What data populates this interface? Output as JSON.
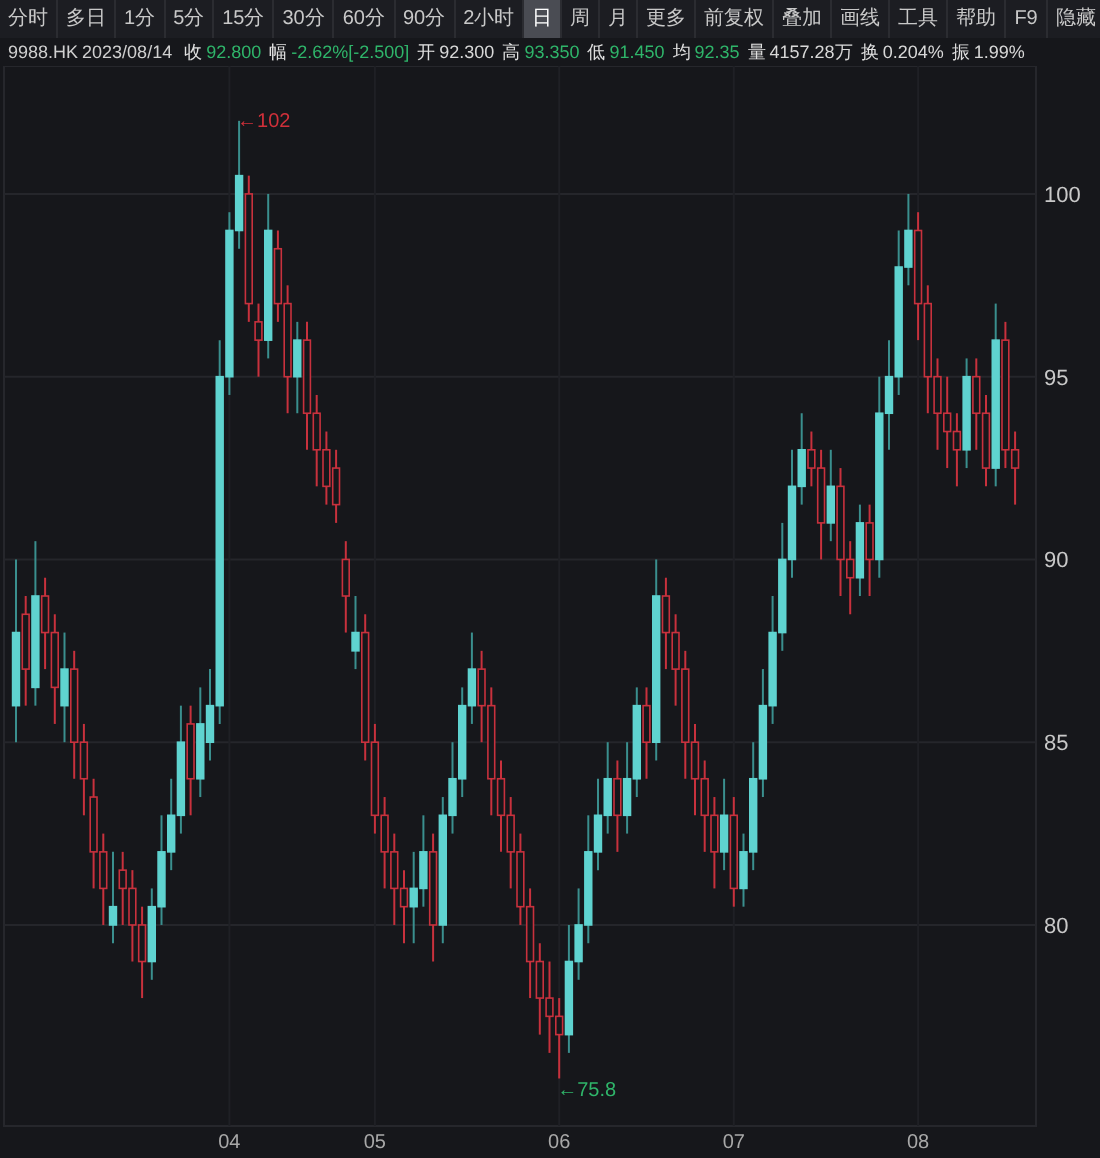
{
  "toolbar": [
    {
      "label": "分时",
      "selected": false
    },
    {
      "label": "多日",
      "selected": false
    },
    {
      "label": "1分",
      "selected": false
    },
    {
      "label": "5分",
      "selected": false
    },
    {
      "label": "15分",
      "selected": false
    },
    {
      "label": "30分",
      "selected": false
    },
    {
      "label": "60分",
      "selected": false
    },
    {
      "label": "90分",
      "selected": false
    },
    {
      "label": "2小时",
      "selected": false
    },
    {
      "label": "日",
      "selected": true
    },
    {
      "label": "周",
      "selected": false
    },
    {
      "label": "月",
      "selected": false
    },
    {
      "label": "更多",
      "selected": false
    }
  ],
  "tools": [
    "前复权",
    "叠加",
    "画线",
    "工具",
    "帮助",
    "F9",
    "隐藏"
  ],
  "quote": {
    "symbol": "9988.HK",
    "date": "2023/08/14",
    "fields": [
      {
        "label": "收",
        "value": "92.800",
        "color": "#2fb56a"
      },
      {
        "label": "幅",
        "value": "-2.62%[-2.500]",
        "color": "#2fb56a"
      },
      {
        "label": "开",
        "value": "92.300",
        "color": "#d8d8d8"
      },
      {
        "label": "高",
        "value": "93.350",
        "color": "#2fb56a"
      },
      {
        "label": "低",
        "value": "91.450",
        "color": "#2fb56a"
      },
      {
        "label": "均",
        "value": "92.35",
        "color": "#2fb56a"
      },
      {
        "label": "量",
        "value": "4157.28万",
        "color": "#d8d8d8"
      },
      {
        "label": "换",
        "value": "0.204%",
        "color": "#d8d8d8"
      },
      {
        "label": "振",
        "value": "1.99%",
        "color": "#d8d8d8"
      }
    ]
  },
  "chart": {
    "chart_data": {
      "type": "candlestick",
      "grid": true,
      "ylim": [
        74.5,
        103.5
      ],
      "yticks": [
        80,
        85,
        90,
        95,
        100
      ],
      "categories": [
        null,
        null,
        null,
        null,
        null,
        null,
        null,
        null,
        null,
        null,
        null,
        null,
        null,
        null,
        null,
        null,
        null,
        null,
        null,
        null,
        null,
        null,
        "04",
        null,
        null,
        null,
        null,
        null,
        null,
        null,
        null,
        null,
        null,
        null,
        null,
        null,
        null,
        "05",
        null,
        null,
        null,
        null,
        null,
        null,
        null,
        null,
        null,
        null,
        null,
        null,
        null,
        null,
        null,
        null,
        null,
        null,
        "06",
        null,
        null,
        null,
        null,
        null,
        null,
        null,
        null,
        null,
        null,
        null,
        null,
        null,
        null,
        null,
        null,
        null,
        "07",
        null,
        null,
        null,
        null,
        null,
        null,
        null,
        null,
        null,
        null,
        null,
        null,
        null,
        null,
        null,
        null,
        null,
        null,
        "08",
        null,
        null,
        null,
        null,
        null,
        null,
        null,
        null,
        null,
        null
      ],
      "ohlc": [
        [
          86,
          90,
          85,
          88
        ],
        [
          88.5,
          89,
          86,
          87
        ],
        [
          86.5,
          90.5,
          86,
          89
        ],
        [
          89,
          89.5,
          87,
          88
        ],
        [
          88,
          88.5,
          85.5,
          86.5
        ],
        [
          86,
          88,
          85,
          87
        ],
        [
          87,
          87.5,
          84,
          85
        ],
        [
          85,
          85.5,
          83,
          84
        ],
        [
          83.5,
          84,
          81,
          82
        ],
        [
          82,
          82.5,
          80,
          81
        ],
        [
          80,
          82,
          79.5,
          80.5
        ],
        [
          81.5,
          82,
          80,
          81
        ],
        [
          81,
          81.5,
          79,
          80
        ],
        [
          80,
          80.5,
          78,
          79
        ],
        [
          79,
          81,
          78.5,
          80.5
        ],
        [
          80.5,
          83,
          80,
          82
        ],
        [
          82,
          84,
          81.5,
          83
        ],
        [
          83,
          86,
          82.5,
          85
        ],
        [
          85.5,
          86,
          83,
          84
        ],
        [
          84,
          86.5,
          83.5,
          85.5
        ],
        [
          85,
          87,
          84.5,
          86
        ],
        [
          86,
          96,
          85.5,
          95
        ],
        [
          95,
          99.5,
          94.5,
          99
        ],
        [
          99,
          102,
          98.5,
          100.5
        ],
        [
          100,
          100.5,
          96.5,
          97
        ],
        [
          96.5,
          97,
          95,
          96
        ],
        [
          96,
          100,
          95.5,
          99
        ],
        [
          98.5,
          99,
          96.5,
          97
        ],
        [
          97,
          97.5,
          94,
          95
        ],
        [
          95,
          96.5,
          94,
          96
        ],
        [
          96,
          96.5,
          93,
          94
        ],
        [
          94,
          94.5,
          92,
          93
        ],
        [
          93,
          93.5,
          91.5,
          92
        ],
        [
          92.5,
          93,
          91,
          91.5
        ],
        [
          90,
          90.5,
          88,
          89
        ],
        [
          87.5,
          89,
          87,
          88
        ],
        [
          88,
          88.5,
          84.5,
          85
        ],
        [
          85,
          85.5,
          82.5,
          83
        ],
        [
          83,
          83.5,
          81,
          82
        ],
        [
          82,
          82.5,
          80,
          81
        ],
        [
          81,
          81.5,
          79.5,
          80.5
        ],
        [
          80.5,
          82,
          79.5,
          81
        ],
        [
          81,
          83,
          80.5,
          82
        ],
        [
          82,
          82.5,
          79,
          80
        ],
        [
          80,
          83.5,
          79.5,
          83
        ],
        [
          83,
          85,
          82.5,
          84
        ],
        [
          84,
          86.5,
          83.5,
          86
        ],
        [
          86,
          88,
          85.5,
          87
        ],
        [
          87,
          87.5,
          85,
          86
        ],
        [
          86,
          86.5,
          83,
          84
        ],
        [
          84,
          84.5,
          82,
          83
        ],
        [
          83,
          83.5,
          81,
          82
        ],
        [
          82,
          82.5,
          80,
          80.5
        ],
        [
          80.5,
          81,
          78,
          79
        ],
        [
          79,
          79.5,
          77,
          78
        ],
        [
          78,
          79,
          76.5,
          77.5
        ],
        [
          77.5,
          78,
          75.8,
          77
        ],
        [
          77,
          80,
          76.5,
          79
        ],
        [
          79,
          81,
          78.5,
          80
        ],
        [
          80,
          83,
          79.5,
          82
        ],
        [
          82,
          84,
          81.5,
          83
        ],
        [
          83,
          85,
          82.5,
          84
        ],
        [
          84,
          84.5,
          82,
          83
        ],
        [
          83,
          85,
          82.5,
          84
        ],
        [
          84,
          86.5,
          83.5,
          86
        ],
        [
          86,
          86.5,
          84,
          85
        ],
        [
          85,
          90,
          84.5,
          89
        ],
        [
          89,
          89.5,
          87,
          88
        ],
        [
          88,
          88.5,
          86,
          87
        ],
        [
          87,
          87.5,
          84,
          85
        ],
        [
          85,
          85.5,
          83,
          84
        ],
        [
          84,
          84.5,
          82,
          83
        ],
        [
          83,
          83.5,
          81,
          82
        ],
        [
          82,
          84,
          81.5,
          83
        ],
        [
          83,
          83.5,
          80.5,
          81
        ],
        [
          81,
          82.5,
          80.5,
          82
        ],
        [
          82,
          85,
          81.5,
          84
        ],
        [
          84,
          87,
          83.5,
          86
        ],
        [
          86,
          89,
          85.5,
          88
        ],
        [
          88,
          91,
          87.5,
          90
        ],
        [
          90,
          93,
          89.5,
          92
        ],
        [
          92,
          94,
          91.5,
          93
        ],
        [
          93,
          93.5,
          92,
          92.5
        ],
        [
          92.5,
          93,
          90,
          91
        ],
        [
          91,
          93,
          90.5,
          92
        ],
        [
          92,
          92.5,
          89,
          90
        ],
        [
          90,
          90.5,
          88.5,
          89.5
        ],
        [
          89.5,
          91.5,
          89,
          91
        ],
        [
          91,
          91.5,
          89,
          90
        ],
        [
          90,
          95,
          89.5,
          94
        ],
        [
          94,
          96,
          93,
          95
        ],
        [
          95,
          99,
          94.5,
          98
        ],
        [
          98,
          100,
          97.5,
          99
        ],
        [
          99,
          99.5,
          96,
          97
        ],
        [
          97,
          97.5,
          94,
          95
        ],
        [
          95,
          95.5,
          93,
          94
        ],
        [
          94,
          95,
          92.5,
          93.5
        ],
        [
          93.5,
          94,
          92,
          93
        ],
        [
          93,
          95.5,
          92.5,
          95
        ],
        [
          95,
          95.5,
          93,
          94
        ],
        [
          94,
          94.5,
          92,
          92.5
        ],
        [
          92.5,
          97,
          92,
          96
        ],
        [
          96,
          96.5,
          92.5,
          93
        ],
        [
          93,
          93.5,
          91.5,
          92.5
        ]
      ],
      "annotations": [
        "←102",
        "←75.8"
      ]
    }
  }
}
